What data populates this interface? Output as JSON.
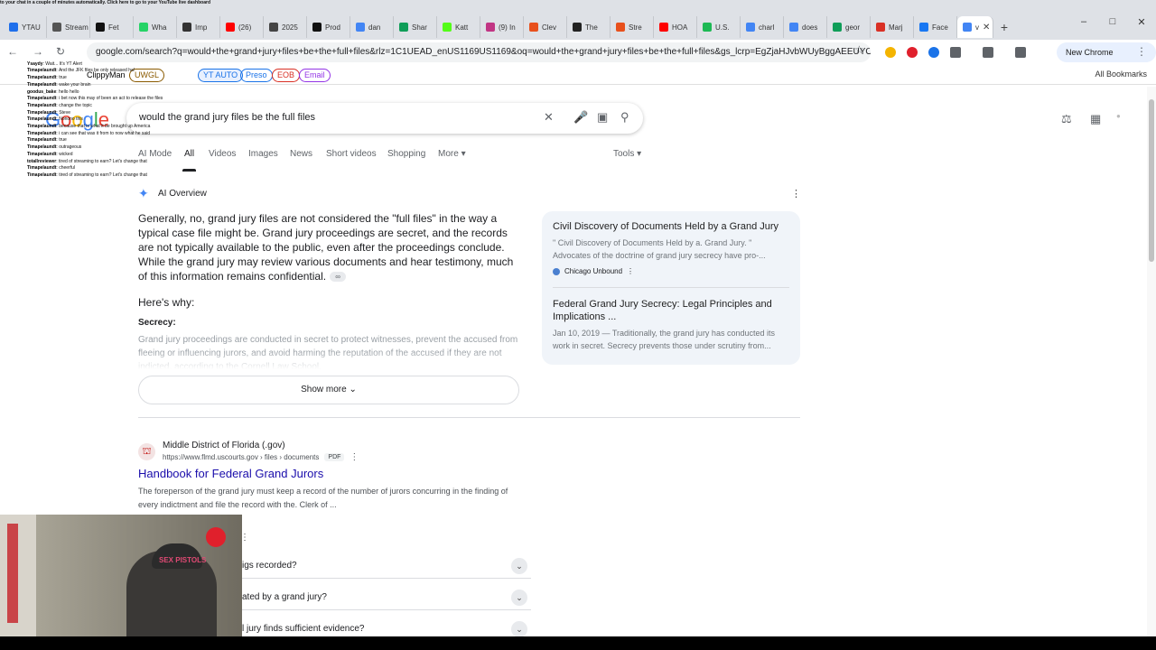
{
  "tabs": [
    {
      "label": "YTAU",
      "color": "#1f6feb"
    },
    {
      "label": "Stream",
      "color": "#555"
    },
    {
      "label": "Fet",
      "color": "#111"
    },
    {
      "label": "Wha",
      "color": "#25d366"
    },
    {
      "label": "Imp",
      "color": "#333"
    },
    {
      "label": "(26)",
      "color": "#ff0000"
    },
    {
      "label": "2025",
      "color": "#444"
    },
    {
      "label": "Prod",
      "color": "#111"
    },
    {
      "label": "dan",
      "color": "#4285f4"
    },
    {
      "label": "Shar",
      "color": "#0f9d58"
    },
    {
      "label": "Katt",
      "color": "#53fc18"
    },
    {
      "label": "(9) In",
      "color": "#c13584"
    },
    {
      "label": "Clev",
      "color": "#e8501c"
    },
    {
      "label": "The",
      "color": "#222"
    },
    {
      "label": "Stre",
      "color": "#e8501c"
    },
    {
      "label": "HOA",
      "color": "#ff0000"
    },
    {
      "label": "U.S.",
      "color": "#1db954"
    },
    {
      "label": "charl",
      "color": "#4285f4"
    },
    {
      "label": "does",
      "color": "#4285f4"
    },
    {
      "label": "geor",
      "color": "#0f9d58"
    },
    {
      "label": "Marj",
      "color": "#d93025"
    },
    {
      "label": "Face",
      "color": "#1877f2"
    },
    {
      "label": "v",
      "color": "#4285f4",
      "active": true
    }
  ],
  "toolbar": {
    "url": "google.com/search?q=would+the+grand+jury+files+be+the+full+files&rlz=1C1UEAD_enUS1169US1169&oq=would+the+grand+jury+files+be+the+full+files&gs_lcrp=EgZjaHJvbWUyBggAEEUYOTIH...",
    "chrome_available": "New Chrome available"
  },
  "bookmarks": {
    "items": [
      {
        "label": "ClippyMan",
        "color": "#1a73e8"
      },
      {
        "label": "UWGL",
        "color": "#8a5a00"
      },
      {
        "label": "YT AUTO",
        "color": "#1a73e8"
      },
      {
        "label": "Preso",
        "color": "#1a73e8"
      },
      {
        "label": "EOB",
        "color": "#d93025"
      },
      {
        "label": "Email",
        "color": "#9334e6"
      }
    ],
    "all_label": "All Bookmarks"
  },
  "search": {
    "query": "would the grand jury files be the full files",
    "tabs": [
      "AI Mode",
      "All",
      "Videos",
      "Images",
      "News",
      "Short videos",
      "Shopping",
      "More"
    ],
    "active_tab": "All",
    "tools": "Tools"
  },
  "ai_overview": {
    "title": "AI Overview",
    "main_text": "Generally, no, grand jury files are not considered the \"full files\" in the way a typical case file might be. Grand jury proceedings are secret, and the records are not typically available to the public, even after the proceedings conclude. While the grand jury may review various documents and hear testimony, much of this information remains confidential.",
    "heres_why": "Here's why:",
    "secrecy_heading": "Secrecy:",
    "secrecy_text": "Grand jury proceedings are conducted in secret to protect witnesses, prevent the accused from fleeing or influencing jurors, and avoid harming the reputation of the accused if they are not indicted, according to the Cornell Law School.",
    "show_more": "Show more",
    "sources": [
      {
        "title": "Civil Discovery of Documents Held by a Grand Jury",
        "snippet": "\" Civil Discovery of Documents Held by a. Grand Jury. \" Advocates of the doctrine of grand jury secrecy have pro-...",
        "site": "Chicago Unbound"
      },
      {
        "title": "Federal Grand Jury Secrecy: Legal Principles and Implications ...",
        "snippet": "Jan 10, 2019 — Traditionally, the grand jury has conducted its work in secret. Secrecy prevents those under scrutiny from..."
      }
    ]
  },
  "result": {
    "site": "Middle District of Florida (.gov)",
    "url": "https://www.flmd.uscourts.gov › files › documents",
    "badge": "PDF",
    "title": "Handbook for Federal Grand Jurors",
    "snippet": "The foreperson of the grand jury must keep a record of the number of jurors concurring in the finding of every indictment and file the record with the. Clerk of ..."
  },
  "paa": [
    "igs recorded?",
    "ated by a grand jury?",
    "l jury finds sufficient evidence?"
  ],
  "chat": {
    "header": "to your chat in a couple of minutes automatically. Click here to go to your YouTube live dashboard",
    "lines": [
      {
        "user": "Ysaydy",
        "text": "Wait... It's YT Alert"
      },
      {
        "user": "Timapelaundt",
        "text": "And the JFK files be only released ha!"
      },
      {
        "user": "Timapelaundt",
        "text": "true"
      },
      {
        "user": "Timapelaundt",
        "text": "wake your brain"
      },
      {
        "user": "goodus_bake",
        "text": "hello hello"
      },
      {
        "user": "Timapelaundt",
        "text": "i bet now this may of been an act to release the files"
      },
      {
        "user": "Timapelaundt",
        "text": "change the topic"
      },
      {
        "user": "Timapelaundt",
        "text": "Steve"
      },
      {
        "user": "Timapelaundt",
        "text": "Nonono this"
      },
      {
        "user": "Timapelaundt",
        "text": "because that is what it be brought up America"
      },
      {
        "user": "Timapelaundt",
        "text": "i can see that was it from to now what he said"
      },
      {
        "user": "Timapelaundt",
        "text": "true"
      },
      {
        "user": "Timapelaundt",
        "text": "outrageous"
      },
      {
        "user": "Timapelaundt",
        "text": "wicked"
      },
      {
        "user": "totallreviewer",
        "text": "tired of streaming to earn? Let's change that"
      },
      {
        "user": "Timapelaundt",
        "text": "cheerful"
      },
      {
        "user": "Timapelaundt",
        "text": "tired of streaming to earn? Let's change that"
      }
    ]
  },
  "webcam": {
    "cap_text": "SEX PISTOLS"
  },
  "colors": {
    "link": "#1a0dab",
    "accent": "#1a73e8",
    "source_bg": "#f0f4f9"
  }
}
